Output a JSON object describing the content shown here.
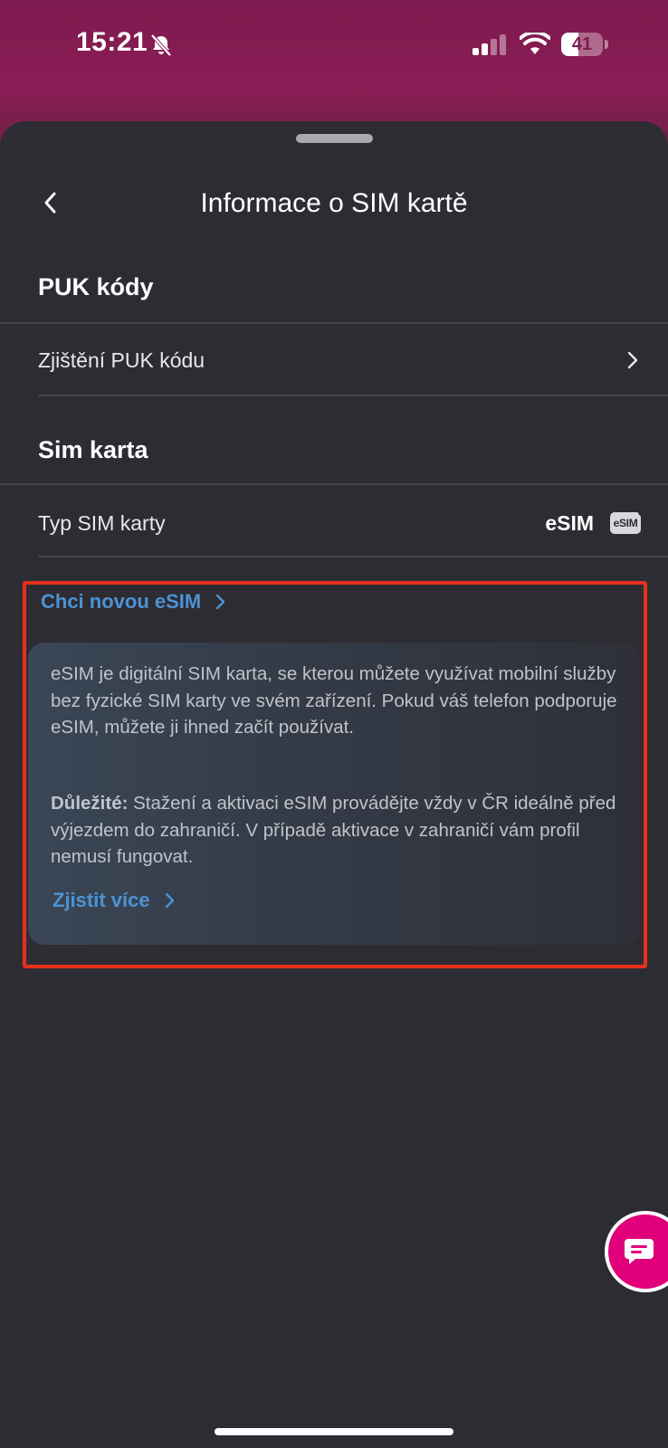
{
  "status_bar": {
    "time": "15:21",
    "battery_percent": "41",
    "battery_level": 0.41,
    "bell_icon": "bell-slash-icon",
    "signal_icon": "cellular-signal-icon",
    "wifi_icon": "wifi-icon"
  },
  "header": {
    "title": "Informace o SIM kartě",
    "back_icon": "chevron-left-icon"
  },
  "sections": {
    "puk": {
      "title": "PUK kódy",
      "row_label": "Zjištění PUK kódu",
      "row_icon": "chevron-right-icon"
    },
    "sim": {
      "title": "Sim karta",
      "type_label": "Typ SIM karty",
      "type_value": "eSIM",
      "badge_text": "eSIM"
    }
  },
  "esim_promo": {
    "link_label": "Chci novou eSIM",
    "paragraph": "eSIM je digitální SIM karta, se kterou můžete využívat mobilní služby bez fyzické SIM karty ve svém zařízení. Pokud váš telefon podporuje eSIM, můžete ji ihned začít používat.",
    "important_label": "Důležité:",
    "important_text": " Stažení a aktivaci eSIM provádějte vždy v ČR ideálně před výjezdem do zahraničí. V případě aktivace v zahraničí vám profil nemusí fungovat.",
    "more_link_label": "Zjistit více"
  },
  "fab": {
    "icon": "chat-bubble-icon"
  },
  "colors": {
    "accent_link": "#4c93d4",
    "sheet_background": "#2d2c33",
    "highlight_border": "#e5311c",
    "fab": "#e2007a",
    "header_gradient": "#8a1d55"
  }
}
